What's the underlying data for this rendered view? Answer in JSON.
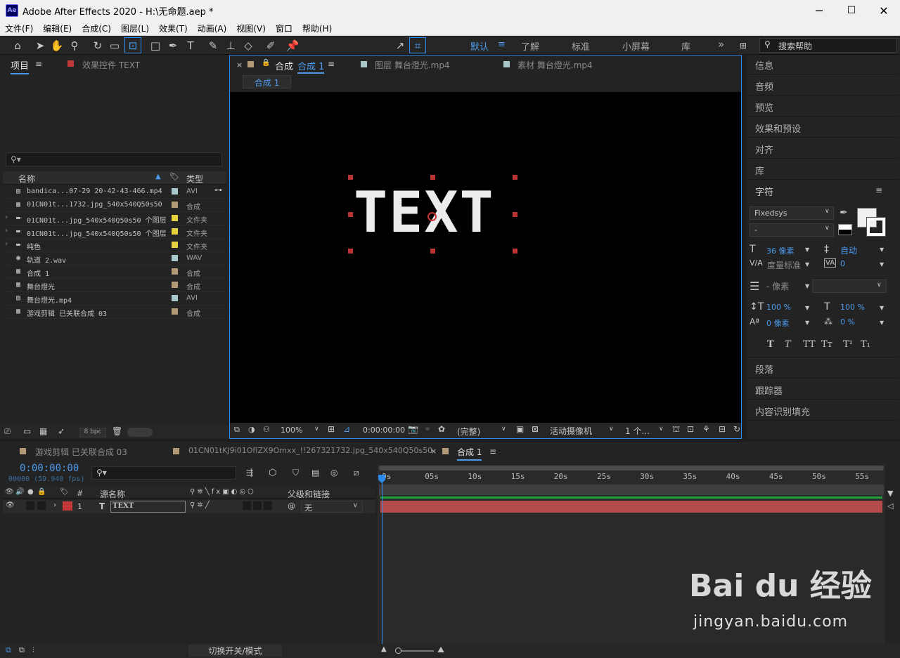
{
  "window": {
    "title": "Adobe After Effects 2020 - H:\\无命题.aep *",
    "logo": "Ae",
    "minimize": "─",
    "maximize": "☐",
    "close": "✕"
  },
  "menu": [
    "文件(F)",
    "编辑(E)",
    "合成(C)",
    "图层(L)",
    "效果(T)",
    "动画(A)",
    "视图(V)",
    "窗口",
    "帮助(H)"
  ],
  "toolbar": {
    "align_label": "对齐",
    "workspaces": [
      "默认",
      "了解",
      "标准",
      "小屏幕",
      "库"
    ],
    "active_workspace": "默认",
    "overflow": "»",
    "search_placeholder": "搜索帮助"
  },
  "project_panel": {
    "tab_project": "项目",
    "tab_effects": "效果控件 TEXT",
    "col_name": "名称",
    "col_type": "类型",
    "items": [
      {
        "name": "bandica...07-29 20-42-43-466.mp4",
        "type": "AVI",
        "color": "#a9c8c9",
        "icon": "video-file-icon",
        "expandable": false
      },
      {
        "name": "01CN01t...1732.jpg_540x540Q50s50",
        "type": "合成",
        "color": "#b39a77",
        "icon": "composition-icon",
        "expandable": false
      },
      {
        "name": "01CN01t...jpg_540x540Q50s50 个图层",
        "type": "文件夹",
        "color": "#e6d13f",
        "icon": "folder-icon",
        "expandable": true
      },
      {
        "name": "01CN01t...jpg_540x540Q50s50 个图层",
        "type": "文件夹",
        "color": "#e6d13f",
        "icon": "folder-icon",
        "expandable": true
      },
      {
        "name": "纯色",
        "type": "文件夹",
        "color": "#e6d13f",
        "icon": "folder-icon",
        "expandable": true
      },
      {
        "name": "轨道 2.wav",
        "type": "WAV",
        "color": "#a9c8c9",
        "icon": "audio-file-icon",
        "expandable": false
      },
      {
        "name": "合成 1",
        "type": "合成",
        "color": "#b39a77",
        "icon": "composition-icon",
        "expandable": false
      },
      {
        "name": "舞台燈光",
        "type": "合成",
        "color": "#b39a77",
        "icon": "composition-icon",
        "expandable": false
      },
      {
        "name": "舞台燈光.mp4",
        "type": "AVI",
        "color": "#a9c8c9",
        "icon": "video-file-icon",
        "expandable": false
      },
      {
        "name": "游戏剪辑 已关联合成 03",
        "type": "合成",
        "color": "#b39a77",
        "icon": "composition-icon",
        "expandable": false
      }
    ],
    "bpc": "8 bpc"
  },
  "viewer": {
    "tab_comp_prefix": "合成",
    "tab_comp_name": "合成 1",
    "tab_layer": "图层 舞台燈光.mp4",
    "tab_footage": "素材 舞台燈光.mp4",
    "breadcrumb": "合成 1",
    "canvas_text": "TEXT",
    "zoom": "100%",
    "timecode": "0:00:00:00",
    "resolution": "(完整)",
    "camera": "活动摄像机",
    "views": "1 个..."
  },
  "right_panel": {
    "sections_top": [
      "信息",
      "音频",
      "预览",
      "效果和预设",
      "对齐",
      "库"
    ],
    "character": {
      "title": "字符",
      "font": "Fixedsys",
      "style": "-",
      "size": "36 像素",
      "leading": "自动",
      "kerning": "度量标准",
      "tracking": "0",
      "stroke_width": "- 像素",
      "vscale": "100 %",
      "hscale": "100 %",
      "baseline": "0 像素",
      "tsume": "0 %",
      "styles": [
        "T",
        "T",
        "TT",
        "Tт",
        "T¹",
        "T₁"
      ]
    },
    "sections_bottom": [
      "段落",
      "跟踪器",
      "内容识别填充"
    ]
  },
  "timeline": {
    "tabs": [
      "游戏剪辑 已关联合成 03",
      "01CN01tKJ9i01OfIZX9Omxx_!!267321732.jpg_540x540Q50s50",
      "合成 1"
    ],
    "tab_colors": [
      "#b39a77",
      "#b39a77",
      "#b39a77"
    ],
    "timecode": "0:00:00:00",
    "frames": "00000 (59.940 fps)",
    "col_index": "#",
    "col_source": "源名称",
    "col_parent": "父级和链接",
    "layer": {
      "index": "1",
      "type": "T",
      "name": "TEXT",
      "parent": "无",
      "color": "#c03a3a"
    },
    "ruler": [
      "0s",
      "05s",
      "10s",
      "15s",
      "20s",
      "25s",
      "30s",
      "35s",
      "40s",
      "45s",
      "50s",
      "55s"
    ],
    "toggle_label": "切换开关/模式"
  },
  "watermark": {
    "brand": "Bai du 经验",
    "url": "jingyan.baidu.com"
  }
}
